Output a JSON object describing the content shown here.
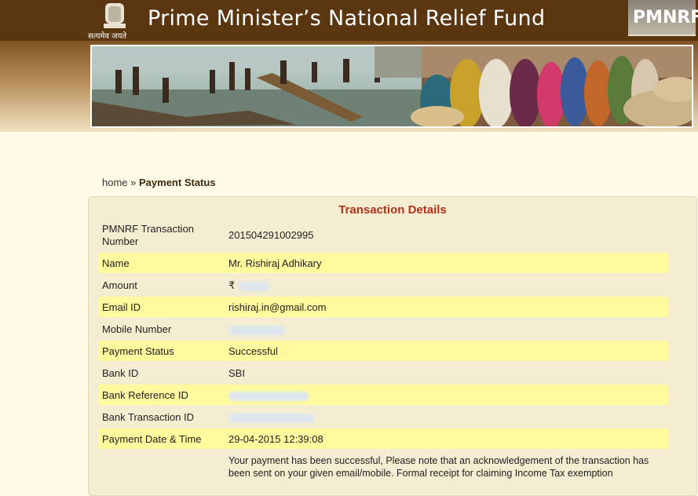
{
  "header": {
    "title": "Prime Minister’s National Relief Fund",
    "emblem_motto": "सत्यमेव जयते",
    "logo_text": "PMNRF"
  },
  "breadcrumb": {
    "home": "home",
    "separator": "»",
    "current": "Payment Status"
  },
  "panel": {
    "title": "Transaction Details",
    "rows": [
      {
        "label": "PMNRF Transaction Number",
        "value": "201504291002995"
      },
      {
        "label": "Name",
        "value": "Mr. Rishiraj Adhikary"
      },
      {
        "label": "Amount",
        "value": "₹"
      },
      {
        "label": "Email ID",
        "value": "rishiraj.in@gmail.com"
      },
      {
        "label": "Mobile Number",
        "value": ""
      },
      {
        "label": "Payment Status",
        "value": "Successful"
      },
      {
        "label": "Bank ID",
        "value": "SBI"
      },
      {
        "label": "Bank Reference ID",
        "value": ""
      },
      {
        "label": "Bank Transaction ID",
        "value": ""
      },
      {
        "label": "Payment Date & Time",
        "value": "29-04-2015 12:39:08"
      }
    ],
    "note": "Your payment has been successful, Please note that an acknowledgement of the transaction has been sent on your given email/mobile. Formal receipt for claiming Income Tax exemption"
  },
  "colors": {
    "header_brown": "#5a3610",
    "page_bg": "#fffbe6",
    "panel_bg": "#f4edd2",
    "row_highlight": "#fffa9e",
    "title_red": "#b5311a"
  }
}
